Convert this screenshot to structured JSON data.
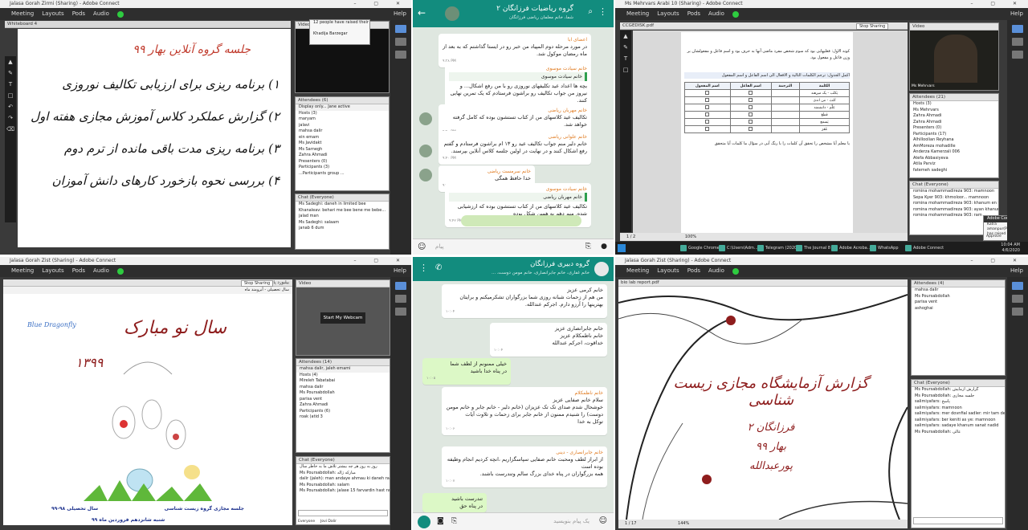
{
  "q1": {
    "title": "Jalasa Gorah Zirmi (Sharing) - Adobe Connect",
    "menu": [
      "Meeting",
      "Layouts",
      "Pods",
      "Audio"
    ],
    "help": "Help",
    "whiteboard_label": "Whiteboard 4",
    "wb_heading": "جلسه گروه آنلاین بهار ۹۹",
    "wb_items": [
      "۱) برنامه ریزی برای ارزیابی تکالیف نوروزی",
      "۲) گزارش عملکرد کلاس آموزش مجازی هفته اول",
      "۳) برنامه ریزی مدت باقی مانده از ترم دوم",
      "۴) بررسی نحوه بازخورد کارهای دانش آموزان"
    ],
    "video_label": "Video",
    "popup_lines": [
      "12 people have raised their hand",
      "Khadija Barzegar"
    ],
    "attendees_label": "Attendees (6)",
    "attendees_filter": "Display only... Jane active",
    "attendees": [
      "Hosts (3)",
      "maryam",
      "jalavi",
      "mahsa dalir",
      "ein emam",
      "Ms Javidakt",
      "Ms Sarnegh",
      "Zahra Ahmadi",
      "Presenters (0)",
      "Participants (3)",
      "...Participants group ..."
    ],
    "chat_label": "Chat (Everyone)",
    "chat": [
      "Ms Sadeghi: daneh in limited bee",
      "Khanaleav: behari me bee bene me bebe...",
      "jalad man",
      "Ms Sadeghi: salaam",
      "janab 6 dum"
    ]
  },
  "q2": {
    "group_title": "گروه ریاضیات فرزانگان ۲",
    "subtitle": "شما، خانم معلمان ریاضی فرزانگان",
    "messages": [
      {
        "sender": "اعضای ابا",
        "text": "در مورد مرحله دوم المپیاد من خبر رو در ایستا گذاشتم که به بعد از ماه رمضان موکول شد.",
        "time": "۹:۳۸ PM"
      },
      {
        "sender": "خانم سیادت موسوی",
        "quote": "خانم سیادت موسوی",
        "text": "بچه ها اعداد عید تکلیفهای نوروزی رو با من رفع اشکال... و نیروز من جواب تکالیف رو براشون فرستادم که یک تمرین نهایی کنند.",
        "time": "۹:۴۰ PM"
      },
      {
        "sender": "خانم مهربان ریاضی",
        "text": "تکالیف عید کلاسهای من از کتاب تستشون بوده که کامل گرفته خواهد شد.",
        "time": "۹:۴۰ PM"
      },
      {
        "sender": "خانم علوانی ریاضی",
        "text": "خانم دلیر منم جواب تکالیف عید رو ۱۳ ام براشون فرستادم و گفتم رفع اشکال کنند و در نهایت در اولین جلسه کلاس آنلاین بپرسند.",
        "time": "۹:۴۰ PM"
      },
      {
        "sender": "خانم سرمست ریاضی",
        "text": "خدا حافظ همگی",
        "time": "۹:۴۱ PM"
      },
      {
        "sender": "خانم سیادت موسوی",
        "quote": "خانم مهربان ریاضی",
        "text": "تکالیف عید کلاسهای من از کتاب تستشون بوده که ارزشیابی شده. منم دهم به همین شکل بوده",
        "time": "۹:۴۲ PM"
      }
    ],
    "input_placeholder": "پیام"
  },
  "q3": {
    "title": "Ms Mehrvars Arabi 10 (Sharing) - Adobe Connect",
    "menu": [
      "Meeting",
      "Layouts",
      "Pods",
      "Audio"
    ],
    "help": "Help",
    "doc_name": "CCGEDISK.pdf",
    "stop_sharing": "Stop Sharing",
    "video_label": "Video",
    "webcam_name": "Ms Mehrvars",
    "doc_paragraph": "کونه الاول: فعلیهایی بود که سوم شخص مفرد ماضی آنها به حرف بود و اسم فاعل و مفعولشان بر وزن فاعل و مفعول بود.",
    "doc_instruction": "اکمل الجدول: ترجم الکلمات التالیة و الافعال الی اسم الفاعل و اسم المفعول",
    "table_head": [
      "الکلمة",
      "الترجمة",
      "اسم الفاعل",
      "اسم المفعول"
    ],
    "table_rows": [
      "یَکتُب - یک میزهند",
      "کَتَبَ - من اندی",
      "عَلَّم - دانشمند",
      "قَطَعَ",
      "یَسمَع",
      "غَفَرَ"
    ],
    "doc_footer": "یا معلم آیا مشخص را تحقق آن کلمات را با رنگ آبی در سؤال ما کلمات آیا متحقق",
    "attendees_label": "Attendees (21)",
    "attendees": [
      "Hosts (3)",
      "Ms Mehrvars",
      "Zahra Ahmadi",
      "Zahra Ahmadi",
      "Presenters (0)",
      "Participants (17)",
      "Alhilloolian Reyhana",
      "AmMoreza mohadille",
      "Anderza Kamerzali 006",
      "Atefa Abbasiyeva",
      "Atila Parviz",
      "fatemeh sadeghi"
    ],
    "chat_label": "Chat (Everyone)",
    "chat": [
      "romina mohammadireza 903: mamnoon",
      "Sepa Kyer 903: khmoloor... mamnoon",
      "romina mohammadireza 903: khanum en vendasma ayo salam",
      "romina mohammadireza 903: ayan khanum",
      "romina mohammadireza 903: ram"
    ],
    "notify_title": "Adobe Connect",
    "notify_text": "Katra amanpur(Participant) has raised hand",
    "notify_buttons": [
      "Approve",
      "Decline"
    ],
    "taskbar": [
      "Google Chrome",
      "C:\\Users\\Adm...",
      "Telegram (2020)",
      "The Journal 8",
      "Adobe Acroba...",
      "WhatsApp",
      "Adobe Connect"
    ],
    "clock": "10:04 AM",
    "date": "4/6/2020",
    "page_indicator": "1 / 2",
    "zoom": "100%"
  },
  "q4": {
    "title": "Jalasa Gorah Zist (Sharing) - Adobe Connect",
    "menu": [
      "Meeting",
      "Layouts",
      "Pods",
      "Audio"
    ],
    "help": "Help",
    "doc_name": "بیلبورد پاییز.jpg",
    "share_sub": "سال تحصیلی - آبرومند ماه",
    "stop_sharing": "Stop Sharing",
    "card_brand": "Blue Dragonfly",
    "card_title": "سال نو مبارک",
    "card_year": "۱۳۹۹",
    "card_caption": "جلسه مجازی گروه زیست شناسی",
    "card_year_label": "سال تحصیلی ۹۸-۹۹",
    "card_date": "شنبه شانزدهم فروردین ماه ۹۹",
    "video_label": "Video",
    "start_webcam": "Start My Webcam",
    "attendees_label": "Attendees (14)",
    "attendees_filter": "mahsa dalir, jaleh emami",
    "attendees": [
      "Hosts (4)",
      "Mireleh Tabatabai",
      "mahsa dalir",
      "Ms Poursabdollah",
      "parisa vent",
      "Zahra Ahmadi",
      "Participants (6)",
      "roak (atid 3"
    ],
    "chat_label": "Chat (Everyone)",
    "chat": [
      "روز به روز هر چه بیشتر تلاش ما به خاطر سال",
      "Ms Poursabdollah: مبارکه ژاله",
      "dalir (jaleh): man andaye ahmau ki daneh ra bye jalase borem",
      "Ms Poursabdollah: salam",
      "Ms Poursabdollah: jalase 15 farvardin hast ra 13:1"
    ],
    "chat_tabs": [
      "Everyone",
      "Jovi Dalir"
    ]
  },
  "q5": {
    "group_title": "گروه دبیری فرزانگان",
    "subtitle": "خانم غفاری، خانم جابرانصاری، خانم مومن دوست، ...",
    "messages": [
      {
        "lines": [
          "خانم کرمی عزیز",
          "من هم از زحمات شبانه روزی شما بزرگواران تشکرمیکنم و برایتان بهترینها را آرزو دارم. اجرکم عندالله."
        ],
        "time": "۱۰:۰۴",
        "out": false
      },
      {
        "lines": [
          "خانم جابرانصاری عزیز",
          "خانم ناظمکلام عزیز",
          "خداقوت، اجرکم عندالله"
        ],
        "time": "۱۰:۰۴",
        "out": false
      },
      {
        "lines": [
          "خیلی ممنونم از لطف شما",
          "در پناه خدا باشید"
        ],
        "time": "۱۰:۰۵",
        "out": true
      },
      {
        "sender": "خانم ناظمکلام",
        "lines": [
          "سلام خانم صفایی عزیز",
          "خوشحال شدم صدای تک تک عزیزان (خانم دلیر - خانم جابر و خانم مومن دوست) را شنیدم ممنون از خانم جابر برای زحمات و تلاوت آیات",
          "توکل به خدا"
        ],
        "time": "۱۰:۰۶",
        "out": false
      },
      {
        "sender": "خانم جابرانصاری - دینی",
        "lines": [
          "از ابراز لطف ومحبت خانم صفایی سپاسگزاریم ،انچه کردیم انجام وظیفه بوده است",
          "همه بزرگواران در پناه خدای بزرگ سالم وتندرست باشند."
        ],
        "time": "۱۰:۰۷",
        "out": false
      },
      {
        "lines": [
          "تندرست باشید",
          "در پناه حق"
        ],
        "time": "۱۰:۰۸",
        "out": true
      }
    ],
    "input_placeholder": "یک پیام بنویسید"
  },
  "q6": {
    "title": "Jalasa Gorah Zist (Sharing) - Adobe Connect",
    "menu": [
      "Meeting",
      "Layouts",
      "Pods",
      "Audio"
    ],
    "help": "Help",
    "doc_name": "bio lab report.pdf",
    "slide_title": "گزارش آزمایشگاه مجازی زیست شناسی",
    "slide_sub": [
      "فرزانگان ۲",
      "بهار ۹۹",
      "پورعبدالله"
    ],
    "attendees_label": "Attendees (4)",
    "attendees": [
      "mahsa dalir",
      "Ms Poursabdollah",
      "parisa vent",
      "ashoghai"
    ],
    "chat_label": "Chat (Everyone)",
    "chat": [
      "Ms Poursabdollah: گزارش آزمایش",
      "Ms Poursabdollah: جلسه مجازی",
      "salimiyafars: پاسخ",
      "salimiyafars: mamnoon",
      "salimiyafars: mer dovnfial sadler: mir tam deram",
      "salimiyafars: ber keniti as ye: mamnoon",
      "salimiyafars: sadaye khanum sanat nadid",
      "Ms Poursabdollah: عالی"
    ],
    "page_indicator": "1 / 17",
    "zoom": "144%"
  },
  "colors": {
    "ac_menubar": "#2e2e2e",
    "wa_header": "#128c7e",
    "wa_bg": "#dfe7e0",
    "wa_outgoing": "#dcf8c6",
    "accent_green": "#2ecc40"
  }
}
